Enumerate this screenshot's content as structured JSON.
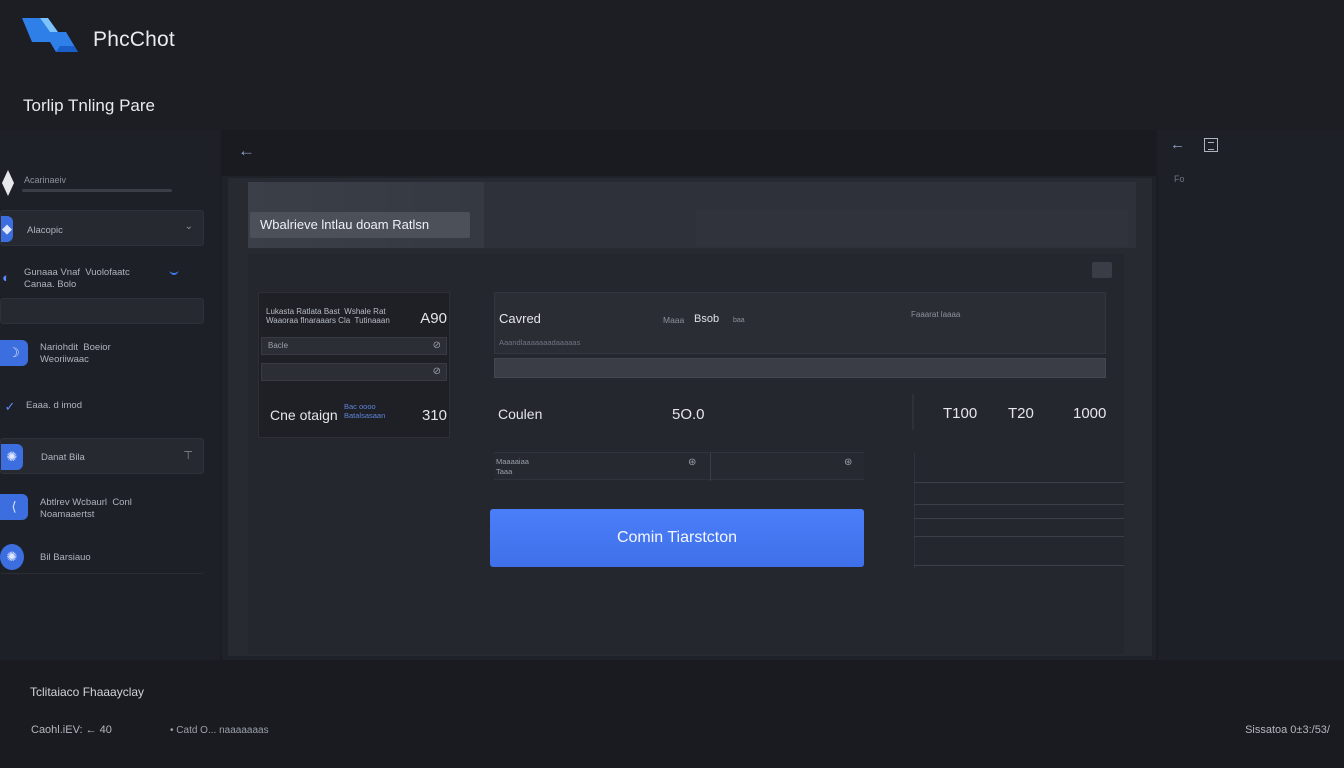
{
  "app": {
    "brand": "PhcChot",
    "page_title": "Torlip Tnling Pare"
  },
  "colors": {
    "accent": "#4a7ef8",
    "background": "#1b1d23",
    "panel": "#272a31"
  },
  "sidebar": {
    "caption": "Acarinaeiv",
    "items": [
      {
        "label": "Alacopic",
        "icon": "shield-icon"
      },
      {
        "label": "Gunaaa Vnaf  Vuolofaatc\nCanaa. Bolo",
        "icon": "chat-icon"
      },
      {
        "label": "",
        "icon": ""
      },
      {
        "label": "Nariohdit  Boeior\nWeoriiwaac",
        "icon": "moon-icon"
      },
      {
        "label": "Eaaa. d  imod",
        "icon": "check-icon"
      },
      {
        "label": "Danat  Bila",
        "icon": "globe-icon"
      },
      {
        "label": "Abtlrev Wcbaurl  Conl\nNoamaaertst",
        "icon": "link-icon"
      },
      {
        "label": "Bil  Barsiauo",
        "icon": "globe-icon"
      }
    ]
  },
  "main": {
    "back_icon": "back-arrow-icon",
    "hero_input": "Wbalrieve lntlau doam Ratlsn",
    "left_table": {
      "head": "Lukasta Ratlata Bast  Wshale Rat\nWaaoraa flnaraaars Cla  Tutinaaan",
      "amount": "A90",
      "row1": "Bacle",
      "row2": "",
      "total_label": "Cne otaign",
      "total_sub": "Bac oooo\nBatalsasaan",
      "total_amount": "3​10"
    },
    "right_block": {
      "title": "Cavred",
      "mid_label": "Maaa",
      "mid_value": "Bsob",
      "mid_extra": "baa",
      "right_label": "Faaarat  laaaa",
      "sub": "Aaandlaaaaaaadaaaaas"
    },
    "mid_row": {
      "label": "Coulen",
      "amount": "5O.0",
      "a": "T100",
      "b": "T20",
      "c": "1000"
    },
    "sub_table": {
      "label": "Maaaaiaa\nTaaa"
    },
    "confirm_label": "Comin Tiarstcton"
  },
  "right_panel": {
    "text": "Fo"
  },
  "footer": {
    "title": "Tclitaiaco Fhaaayclay",
    "left": "Caohl.iEV:  ←  40",
    "mid": "• Catd O...  naaaaaaas",
    "right": "Sissatoa 0±3:/53/"
  }
}
